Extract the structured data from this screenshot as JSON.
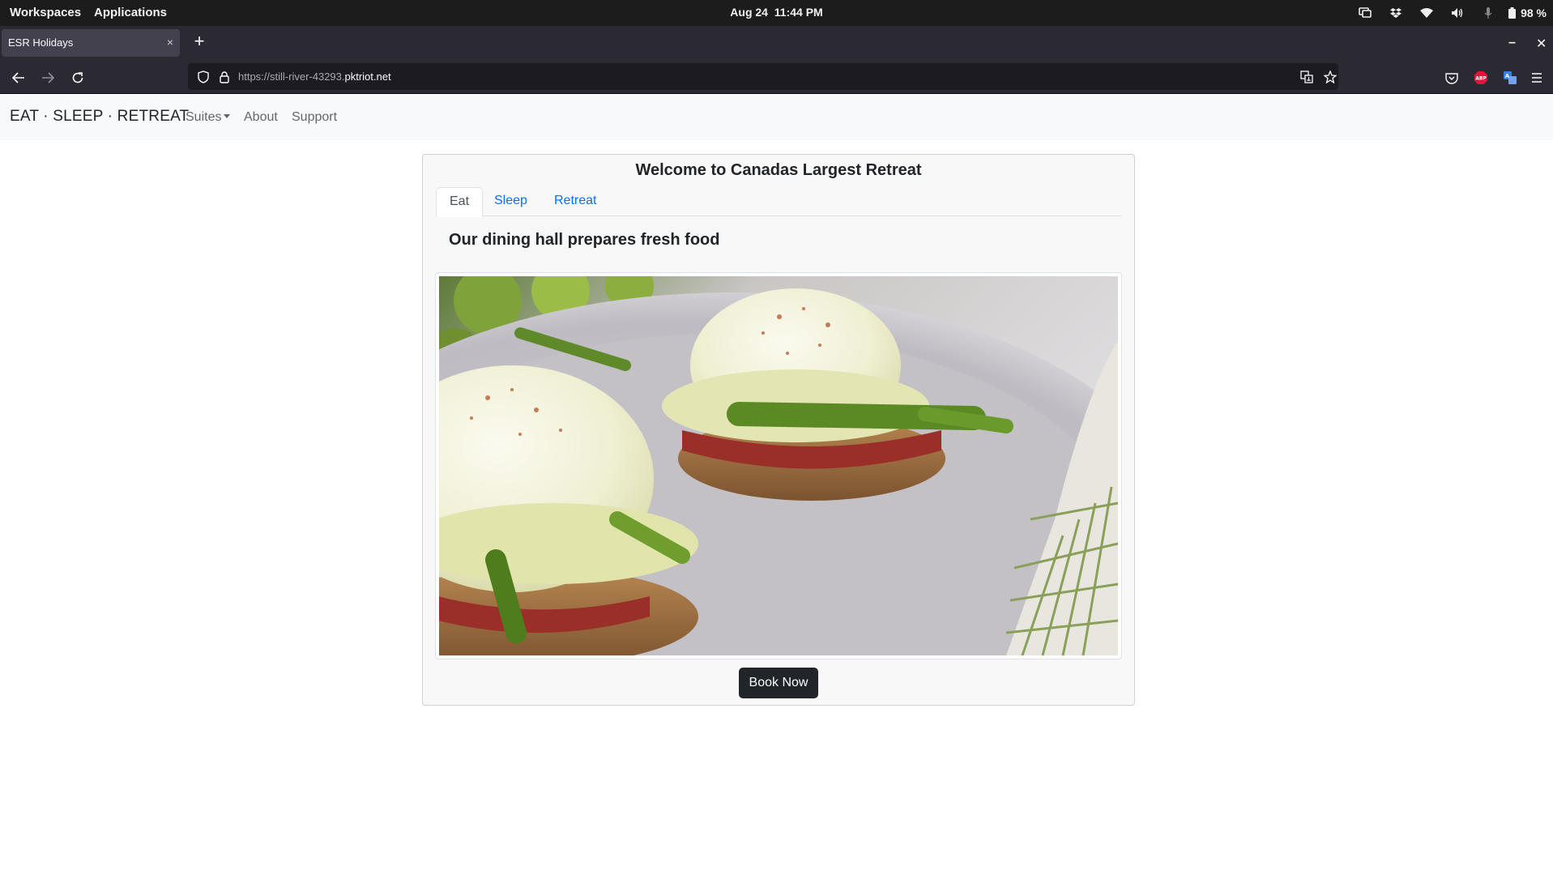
{
  "os_bar": {
    "workspaces": "Workspaces",
    "applications": "Applications",
    "date": "Aug 24",
    "time": "11:44 PM",
    "battery": "98 %",
    "icons": [
      "display-icon",
      "dropbox-icon",
      "wifi-icon",
      "volume-icon",
      "microphone-icon",
      "battery-icon"
    ]
  },
  "browser": {
    "tab_title": "ESR Holidays",
    "tab_close": "×",
    "new_tab": "+",
    "url_prefix": "https://still-river-43293.",
    "url_domain": "pktriot.net",
    "window_minimize": "–",
    "window_close": "✕"
  },
  "site": {
    "brand": "EAT · SLEEP · RETREAT",
    "nav": {
      "suites": "Suites",
      "about": "About",
      "support": "Support"
    }
  },
  "card": {
    "title": "Welcome to Canadas Largest Retreat",
    "tabs": [
      "Eat",
      "Sleep",
      "Retreat"
    ],
    "active_tab": "Eat",
    "heading": "Our dining hall prepares fresh food",
    "image_subject": "eggs benedict with asparagus on a plate",
    "book_button": "Book Now"
  },
  "colors": {
    "topbar": "#1c1c1c",
    "browser_chrome": "#2b2a33",
    "site_nav_bg": "#f8f9fa",
    "link": "#0d6efd",
    "button_dark": "#212529"
  }
}
